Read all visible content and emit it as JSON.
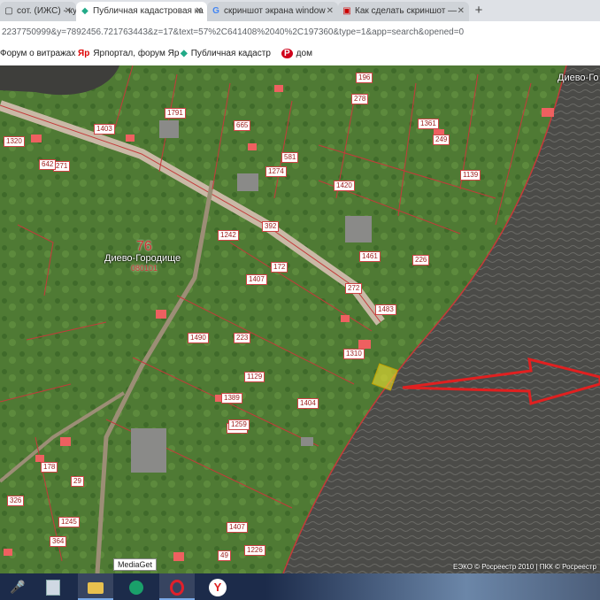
{
  "browser": {
    "tabs": [
      {
        "label": "сот. (ИЖС) - ку",
        "favicon": "page-icon",
        "active": false
      },
      {
        "label": "Публичная кадастровая ка",
        "favicon": "cadastre-icon",
        "active": true
      },
      {
        "label": "скриншот экрана window",
        "favicon": "google-icon",
        "active": false
      },
      {
        "label": "Как сделать скриншот —",
        "favicon": "video-icon",
        "active": false
      }
    ],
    "new_tab": "+",
    "url": "2237750999&y=7892456.721763443&z=17&text=57%2C641408%2040%2C197360&type=1&app=search&opened=0"
  },
  "bookmarks": [
    {
      "label": "Форум о витражах",
      "icon": ""
    },
    {
      "label": "Ярпортал, форум Яр",
      "icon": "Яр"
    },
    {
      "label": "Публичная кадастр",
      "icon": "◆"
    },
    {
      "label": "дом",
      "icon": "P"
    }
  ],
  "map": {
    "place_name": "Диево-Городище",
    "place_name_right": "Диево-Го",
    "district_number": "76",
    "district_code": "080101",
    "parcel_labels": [
      "1403",
      "1791",
      "665",
      "278",
      "1361",
      "1139",
      "249",
      "581",
      "1420",
      "196",
      "1274",
      "1242",
      "392",
      "1407",
      "1461",
      "172",
      "1483",
      "272",
      "226",
      "1310",
      "271",
      "1320",
      "642",
      "1129",
      "1490",
      "1404",
      "1389",
      "1412",
      "223",
      "1226",
      "178",
      "29",
      "1407",
      "326",
      "1245",
      "49",
      "364",
      "1259"
    ],
    "copyright": "ЕЭКО © Росреестр 2010 | ПКК © Росреестр"
  },
  "taskbar": {
    "tooltip": "MediaGet",
    "items": [
      {
        "name": "microphone-icon",
        "glyph": "🎤"
      },
      {
        "name": "calculator-icon",
        "glyph": "▦"
      },
      {
        "name": "explorer-icon",
        "glyph": "📁"
      },
      {
        "name": "mediaget-icon",
        "glyph": "◉"
      },
      {
        "name": "opera-icon",
        "glyph": "O"
      },
      {
        "name": "yandex-icon",
        "glyph": "Y"
      }
    ]
  }
}
